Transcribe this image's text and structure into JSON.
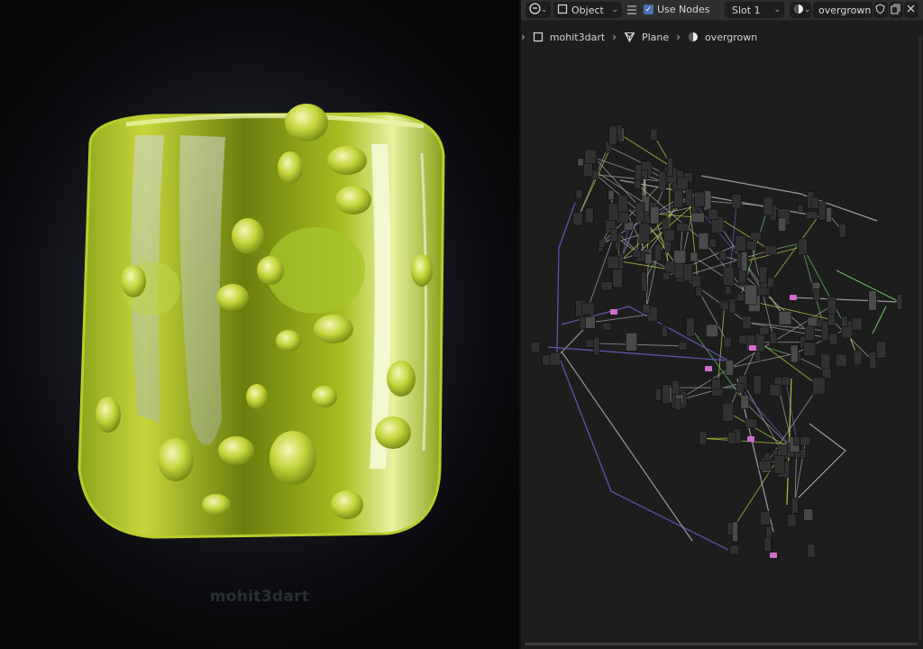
{
  "render": {
    "watermark": "mohit3dart",
    "colors": {
      "background": "#0b0c0f",
      "moss": "#9fbd21",
      "slime": "#c7d934"
    }
  },
  "editor": {
    "header": {
      "editor_type_icon": "shader-editor-icon",
      "object_mode": "Object",
      "menu_icon": "hamburger-icon",
      "use_nodes_label": "Use Nodes",
      "use_nodes_checked": true,
      "slot": "Slot 1",
      "material_name": "overgrown",
      "icons": [
        "material-sphere-icon",
        "fake-user-shield-icon",
        "duplicate-icon",
        "close-icon"
      ]
    },
    "breadcrumb": [
      {
        "label": "mohit3dart",
        "icon": "object-icon"
      },
      {
        "label": "Plane",
        "icon": "mesh-icon"
      },
      {
        "label": "overgrown",
        "icon": "material-sphere-icon"
      }
    ],
    "colors": {
      "background": "#1d1d1d",
      "header": "#2e2e2e",
      "wire_grey": "#a8a8a8",
      "wire_purple": "#6d5cc8",
      "wire_yellow": "#c8d24a",
      "wire_green": "#6cc86a",
      "node_pink": "#d56bd0"
    }
  }
}
